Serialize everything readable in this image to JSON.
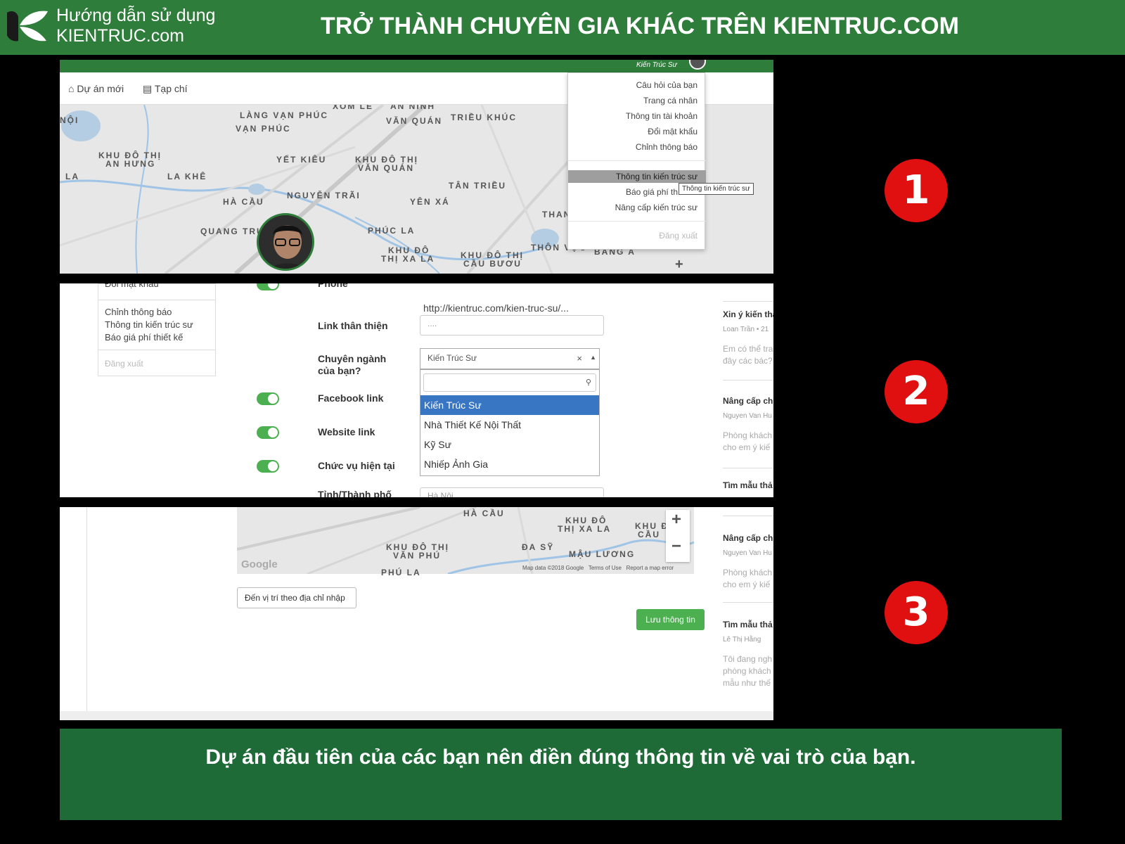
{
  "header": {
    "logo_line1": "Hướng dẫn sử dụng",
    "logo_line2": "KIENTRUC.com",
    "title": "TRỞ THÀNH CHUYÊN GIA KHÁC TRÊN KIENTRUC.COM",
    "bg_color": "#2e7d3a"
  },
  "panel1": {
    "user_name": "Kiến Trúc Sư",
    "nav": {
      "new_project": "Dự án mới",
      "magazine": "Tạp chí"
    },
    "map_labels": [
      "NỘI",
      "LÀNG VẠN PHÚC",
      "VẠN PHÚC",
      "XÓM LE",
      "AN NINH",
      "VĂN QUÁN",
      "TRIỀU KHÚC",
      "KHU ĐÔ THỊ",
      "AN HƯNG",
      "LA",
      "LA KHÊ",
      "YẾT KIÊU",
      "KHU ĐÔ THỊ",
      "VĂN QUÁN",
      "TÂN TRIỀU",
      "HÀ CẦU",
      "NGUYỄN TRÃI",
      "YÊN XÁ",
      "THAN",
      "QUANG TRUNG",
      "PHÚC LA",
      "KHU ĐÔ",
      "THỊ XA LA",
      "KHU ĐÔ THỊ",
      "CẦU BƯƠU",
      "THÔN VỰC",
      "BẰNG A"
    ],
    "dropdown": [
      "Câu hỏi của bạn",
      "Trang cá nhân",
      "Thông tin tài khoản",
      "Đổi mật khẩu",
      "Chỉnh thông báo",
      "Thông tin kiến trúc sư",
      "Báo giá phí th",
      "Nâng cấp kiến trúc sư",
      "Đăng xuất"
    ],
    "tooltip": "Thông tin kiến trúc sư"
  },
  "panel2": {
    "side_menu": [
      "Đổi mật khẩu",
      "Chỉnh thông báo",
      "Thông tin kiến trúc sư",
      "Báo giá phí thiết kế",
      "Đăng xuất"
    ],
    "url_text": "http://kientruc.com/kien-truc-su/...",
    "labels": {
      "phone": "Phone",
      "friendly_link": "Link thân thiện",
      "specialty_line1": "Chuyên ngành",
      "specialty_line2": "của bạn?",
      "facebook": "Facebook link",
      "website": "Website link",
      "position": "Chức vụ hiện tại",
      "province": "Tỉnh/Thành phố"
    },
    "friendly_link_value": "....",
    "select_value": "Kiến Trúc Sư",
    "options": [
      "Kiến Trúc Sư",
      "Nhà Thiết Kế Nội Thất",
      "Kỹ Sư",
      "Nhiếp Ảnh Gia"
    ],
    "province_value": "Hà Nội",
    "right_col": [
      {
        "title": "Xin ý kiến tha",
        "author": "Loan Trần",
        "time": "21",
        "body": [
          "Em có thể tra",
          "đây các bác?"
        ]
      },
      {
        "title": "Nâng cấp ch",
        "author": "Nguyen Van Hu",
        "time": "",
        "body": [
          "Phòng khách",
          "cho em ý kiế"
        ]
      },
      {
        "title": "Tìm mẫu thả",
        "author": "",
        "time": "",
        "body": []
      }
    ]
  },
  "panel3": {
    "map_labels": [
      "HÀ CẦU",
      "KHU ĐÔ",
      "THỊ XA LA",
      "KHU Đ",
      "CẦU",
      "KHU ĐÔ THỊ",
      "VĂN PHÚ",
      "ĐA SỸ",
      "MẬU LƯƠNG",
      "PHÚ LA"
    ],
    "map_footer": "Map data ©2018 Google   Terms of Use   Report a map error",
    "google": "Google",
    "go_button": "Đến vị trí theo địa chỉ nhập",
    "save_button": "Lưu thông tin",
    "right_col": [
      {
        "title": "Nâng cấp ch",
        "author": "Nguyen Van Hu",
        "body": [
          "Phòng khách",
          "cho em ý kiế"
        ]
      },
      {
        "title": "Tìm mẫu thả",
        "author": "Lê Thị Hằng",
        "body": [
          "Tôi đang ngh",
          "phòng khách",
          "mẫu như thế"
        ]
      }
    ]
  },
  "steps": [
    "1",
    "2",
    "3"
  ],
  "banner": {
    "text": "Dự án đầu tiên của các bạn nên điền đúng thông tin về vai trò của bạn."
  }
}
